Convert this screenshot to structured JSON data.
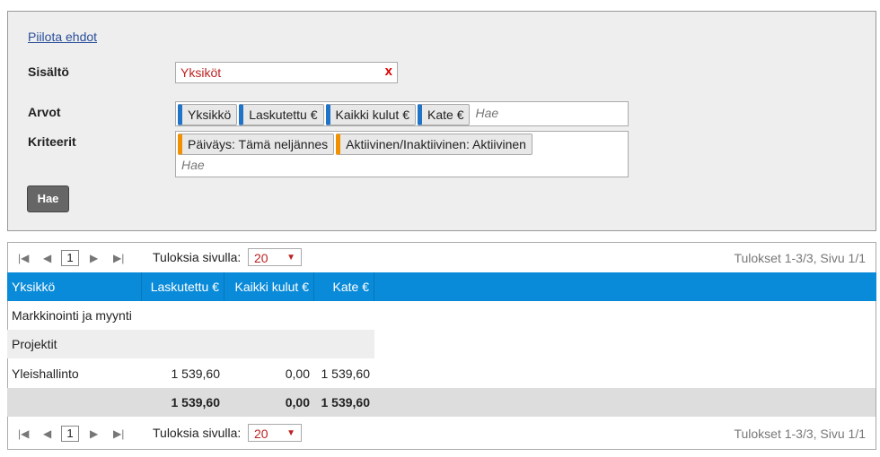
{
  "filters": {
    "toggle_label": "Piilota ehdot",
    "content_label": "Sisältö",
    "content_value": "Yksiköt",
    "values_label": "Arvot",
    "values_chips": [
      "Yksikkö",
      "Laskutettu €",
      "Kaikki kulut €",
      "Kate €"
    ],
    "values_placeholder": "Hae",
    "criteria_label": "Kriteerit",
    "criteria_chips": [
      "Päiväys: Tämä neljännes",
      "Aktiivinen/Inaktiivinen: Aktiivinen"
    ],
    "criteria_placeholder": "Hae",
    "search_button": "Hae"
  },
  "pager": {
    "page": "1",
    "per_page_label": "Tuloksia sivulla:",
    "per_page_value": "20",
    "info": "Tulokset 1-3/3, Sivu 1/1"
  },
  "table": {
    "headers": [
      "Yksikkö",
      "Laskutettu €",
      "Kaikki kulut €",
      "Kate €"
    ],
    "rows": [
      [
        "Markkinointi ja myynti",
        "",
        "",
        ""
      ],
      [
        "Projektit",
        "",
        "",
        ""
      ],
      [
        "Yleishallinto",
        "1 539,60",
        "0,00",
        "1 539,60"
      ]
    ],
    "totals": [
      "",
      "1 539,60",
      "0,00",
      "1 539,60"
    ]
  }
}
